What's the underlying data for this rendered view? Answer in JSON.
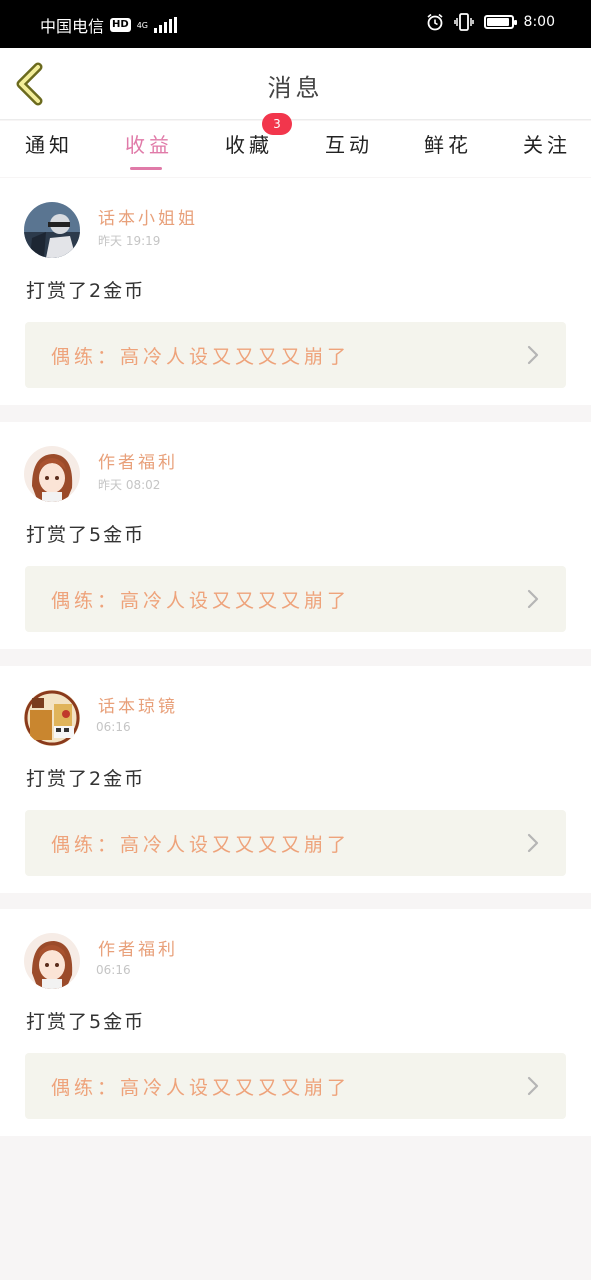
{
  "status_bar": {
    "carrier": "中国电信",
    "hd": "HD",
    "network": "4G",
    "time": "8:00",
    "battery_level": 0.9
  },
  "header": {
    "title": "消息",
    "back_icon": "chevron-left-icon"
  },
  "tabs": [
    {
      "label": "通知",
      "active": false
    },
    {
      "label": "收益",
      "active": true
    },
    {
      "label": "收藏",
      "active": false,
      "badge": "3"
    },
    {
      "label": "互动",
      "active": false
    },
    {
      "label": "鲜花",
      "active": false
    },
    {
      "label": "关注",
      "active": false
    }
  ],
  "colors": {
    "accent": "#e07aa8",
    "username": "#e8a07a",
    "work_text": "#eea37b",
    "badge": "#f2364c",
    "work_bg": "#f4f4ed"
  },
  "notifications": [
    {
      "user": "话本小姐姐",
      "time": "昨天 19:19",
      "message": "打赏了2金币",
      "work": "偶练：高冷人设又又又又崩了",
      "avatar": "avatar-1"
    },
    {
      "user": "作者福利",
      "time": "昨天 08:02",
      "message": "打赏了5金币",
      "work": "偶练：高冷人设又又又又崩了",
      "avatar": "avatar-2"
    },
    {
      "user": "话本琼镜",
      "time": "06:16",
      "message": "打赏了2金币",
      "work": "偶练：高冷人设又又又又崩了",
      "avatar": "avatar-3"
    },
    {
      "user": "作者福利",
      "time": "06:16",
      "message": "打赏了5金币",
      "work": "偶练：高冷人设又又又又崩了",
      "avatar": "avatar-2"
    }
  ]
}
